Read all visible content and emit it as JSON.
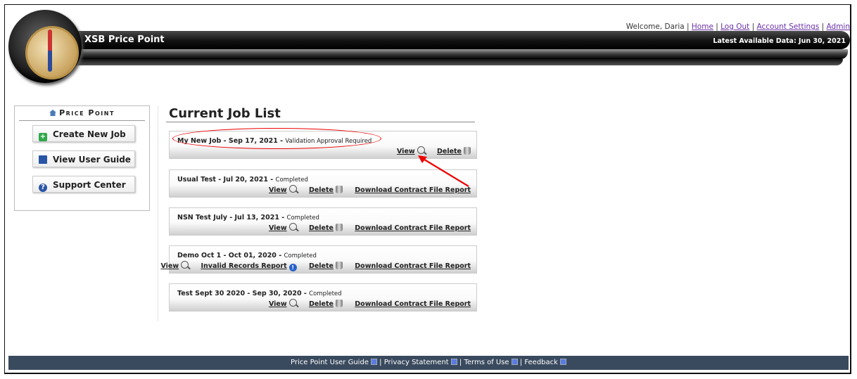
{
  "header": {
    "app_title": "XSB Price Point",
    "welcome": "Welcome, Daria",
    "links": [
      "Home",
      "Log Out",
      "Account Settings",
      "Admin"
    ],
    "latest_data": "Latest Available Data: Jun 30, 2021"
  },
  "sidebar": {
    "heading": "Price Point",
    "buttons": [
      "Create New Job",
      "View User Guide",
      "Support Center"
    ]
  },
  "main": {
    "title": "Current Job List",
    "jobs": [
      {
        "name": "My New Job - Sep 17, 2021",
        "status": "Validation Approval Required",
        "view": "View",
        "invalid": "",
        "delete": "Delete",
        "download": ""
      },
      {
        "name": "Usual Test - Jul 20, 2021",
        "status": "Completed",
        "view": "View",
        "invalid": "",
        "delete": "Delete",
        "download": "Download Contract File Report"
      },
      {
        "name": "NSN Test July - Jul 13, 2021",
        "status": "Completed",
        "view": "View",
        "invalid": "",
        "delete": "Delete",
        "download": "Download Contract File Report"
      },
      {
        "name": "Demo Oct 1 - Oct 01, 2020",
        "status": "Completed",
        "view": "View",
        "invalid": "Invalid Records Report",
        "delete": "Delete",
        "download": "Download Contract File Report"
      },
      {
        "name": "Test Sept 30 2020 - Sep 30, 2020",
        "status": "Completed",
        "view": "View",
        "invalid": "",
        "delete": "Delete",
        "download": "Download Contract File Report"
      }
    ]
  },
  "footer": {
    "links": [
      "Price Point User Guide",
      "Privacy Statement",
      "Terms of Use",
      "Feedback"
    ]
  }
}
